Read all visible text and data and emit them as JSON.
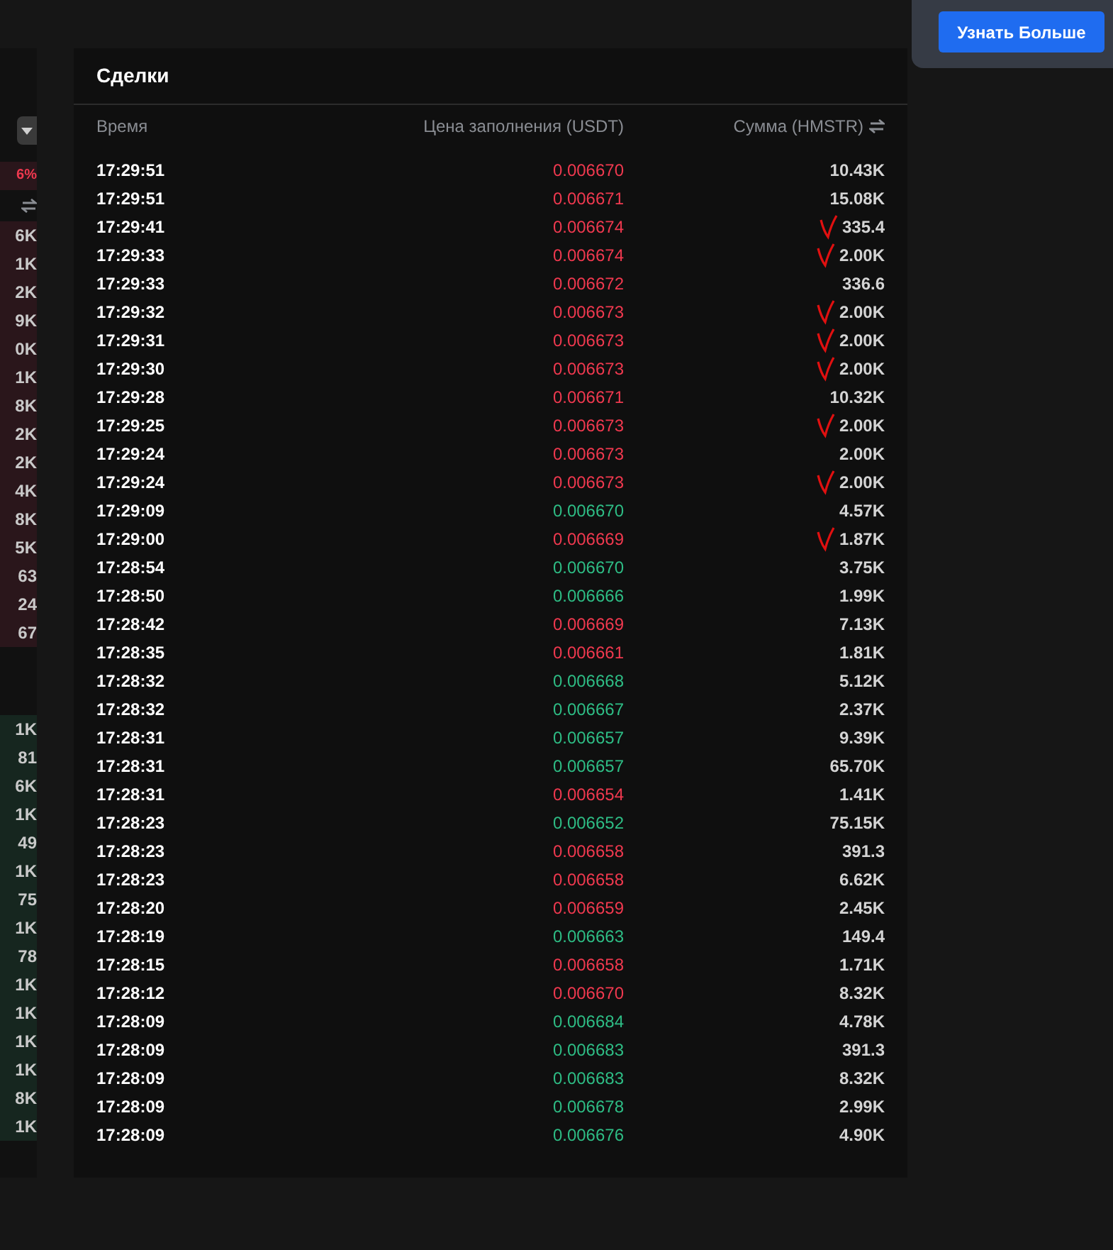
{
  "order_book": {
    "change": "6%",
    "asks": [
      "6K",
      "1K",
      "2K",
      "9K",
      "0K",
      "1K",
      "8K",
      "2K",
      "2K",
      "4K",
      "8K",
      "5K",
      "63",
      "24",
      "67"
    ],
    "bids": [
      "1K",
      "81",
      "6K",
      "1K",
      "49",
      "1K",
      "75",
      "1K",
      "78",
      "1K",
      "1K",
      "1K",
      "1K",
      "8K",
      "1K"
    ]
  },
  "promo": {
    "button": "Узнать Больше"
  },
  "trades": {
    "title": "Сделки",
    "columns": [
      "Время",
      "Цена заполнения (USDT)",
      "Сумма (HMSTR)"
    ],
    "rows": [
      {
        "time": "17:29:51",
        "price": "0.006670",
        "kind": "sell",
        "amount": "10.43K",
        "marked": false
      },
      {
        "time": "17:29:51",
        "price": "0.006671",
        "kind": "sell",
        "amount": "15.08K",
        "marked": false
      },
      {
        "time": "17:29:41",
        "price": "0.006674",
        "kind": "sell",
        "amount": "335.4",
        "marked": true
      },
      {
        "time": "17:29:33",
        "price": "0.006674",
        "kind": "sell",
        "amount": "2.00K",
        "marked": true
      },
      {
        "time": "17:29:33",
        "price": "0.006672",
        "kind": "sell",
        "amount": "336.6",
        "marked": false
      },
      {
        "time": "17:29:32",
        "price": "0.006673",
        "kind": "sell",
        "amount": "2.00K",
        "marked": true
      },
      {
        "time": "17:29:31",
        "price": "0.006673",
        "kind": "sell",
        "amount": "2.00K",
        "marked": true
      },
      {
        "time": "17:29:30",
        "price": "0.006673",
        "kind": "sell",
        "amount": "2.00K",
        "marked": true
      },
      {
        "time": "17:29:28",
        "price": "0.006671",
        "kind": "sell",
        "amount": "10.32K",
        "marked": false
      },
      {
        "time": "17:29:25",
        "price": "0.006673",
        "kind": "sell",
        "amount": "2.00K",
        "marked": true
      },
      {
        "time": "17:29:24",
        "price": "0.006673",
        "kind": "sell",
        "amount": "2.00K",
        "marked": false
      },
      {
        "time": "17:29:24",
        "price": "0.006673",
        "kind": "sell",
        "amount": "2.00K",
        "marked": true
      },
      {
        "time": "17:29:09",
        "price": "0.006670",
        "kind": "buy",
        "amount": "4.57K",
        "marked": false
      },
      {
        "time": "17:29:00",
        "price": "0.006669",
        "kind": "sell",
        "amount": "1.87K",
        "marked": true
      },
      {
        "time": "17:28:54",
        "price": "0.006670",
        "kind": "buy",
        "amount": "3.75K",
        "marked": false
      },
      {
        "time": "17:28:50",
        "price": "0.006666",
        "kind": "buy",
        "amount": "1.99K",
        "marked": false
      },
      {
        "time": "17:28:42",
        "price": "0.006669",
        "kind": "sell",
        "amount": "7.13K",
        "marked": false
      },
      {
        "time": "17:28:35",
        "price": "0.006661",
        "kind": "sell",
        "amount": "1.81K",
        "marked": false
      },
      {
        "time": "17:28:32",
        "price": "0.006668",
        "kind": "buy",
        "amount": "5.12K",
        "marked": false
      },
      {
        "time": "17:28:32",
        "price": "0.006667",
        "kind": "buy",
        "amount": "2.37K",
        "marked": false
      },
      {
        "time": "17:28:31",
        "price": "0.006657",
        "kind": "buy",
        "amount": "9.39K",
        "marked": false
      },
      {
        "time": "17:28:31",
        "price": "0.006657",
        "kind": "buy",
        "amount": "65.70K",
        "marked": false
      },
      {
        "time": "17:28:31",
        "price": "0.006654",
        "kind": "sell",
        "amount": "1.41K",
        "marked": false
      },
      {
        "time": "17:28:23",
        "price": "0.006652",
        "kind": "buy",
        "amount": "75.15K",
        "marked": false
      },
      {
        "time": "17:28:23",
        "price": "0.006658",
        "kind": "sell",
        "amount": "391.3",
        "marked": false
      },
      {
        "time": "17:28:23",
        "price": "0.006658",
        "kind": "sell",
        "amount": "6.62K",
        "marked": false
      },
      {
        "time": "17:28:20",
        "price": "0.006659",
        "kind": "sell",
        "amount": "2.45K",
        "marked": false
      },
      {
        "time": "17:28:19",
        "price": "0.006663",
        "kind": "buy",
        "amount": "149.4",
        "marked": false
      },
      {
        "time": "17:28:15",
        "price": "0.006658",
        "kind": "sell",
        "amount": "1.71K",
        "marked": false
      },
      {
        "time": "17:28:12",
        "price": "0.006670",
        "kind": "sell",
        "amount": "8.32K",
        "marked": false
      },
      {
        "time": "17:28:09",
        "price": "0.006684",
        "kind": "buy",
        "amount": "4.78K",
        "marked": false
      },
      {
        "time": "17:28:09",
        "price": "0.006683",
        "kind": "buy",
        "amount": "391.3",
        "marked": false
      },
      {
        "time": "17:28:09",
        "price": "0.006683",
        "kind": "buy",
        "amount": "8.32K",
        "marked": false
      },
      {
        "time": "17:28:09",
        "price": "0.006678",
        "kind": "buy",
        "amount": "2.99K",
        "marked": false
      },
      {
        "time": "17:28:09",
        "price": "0.006676",
        "kind": "buy",
        "amount": "4.90K",
        "marked": false
      }
    ]
  }
}
